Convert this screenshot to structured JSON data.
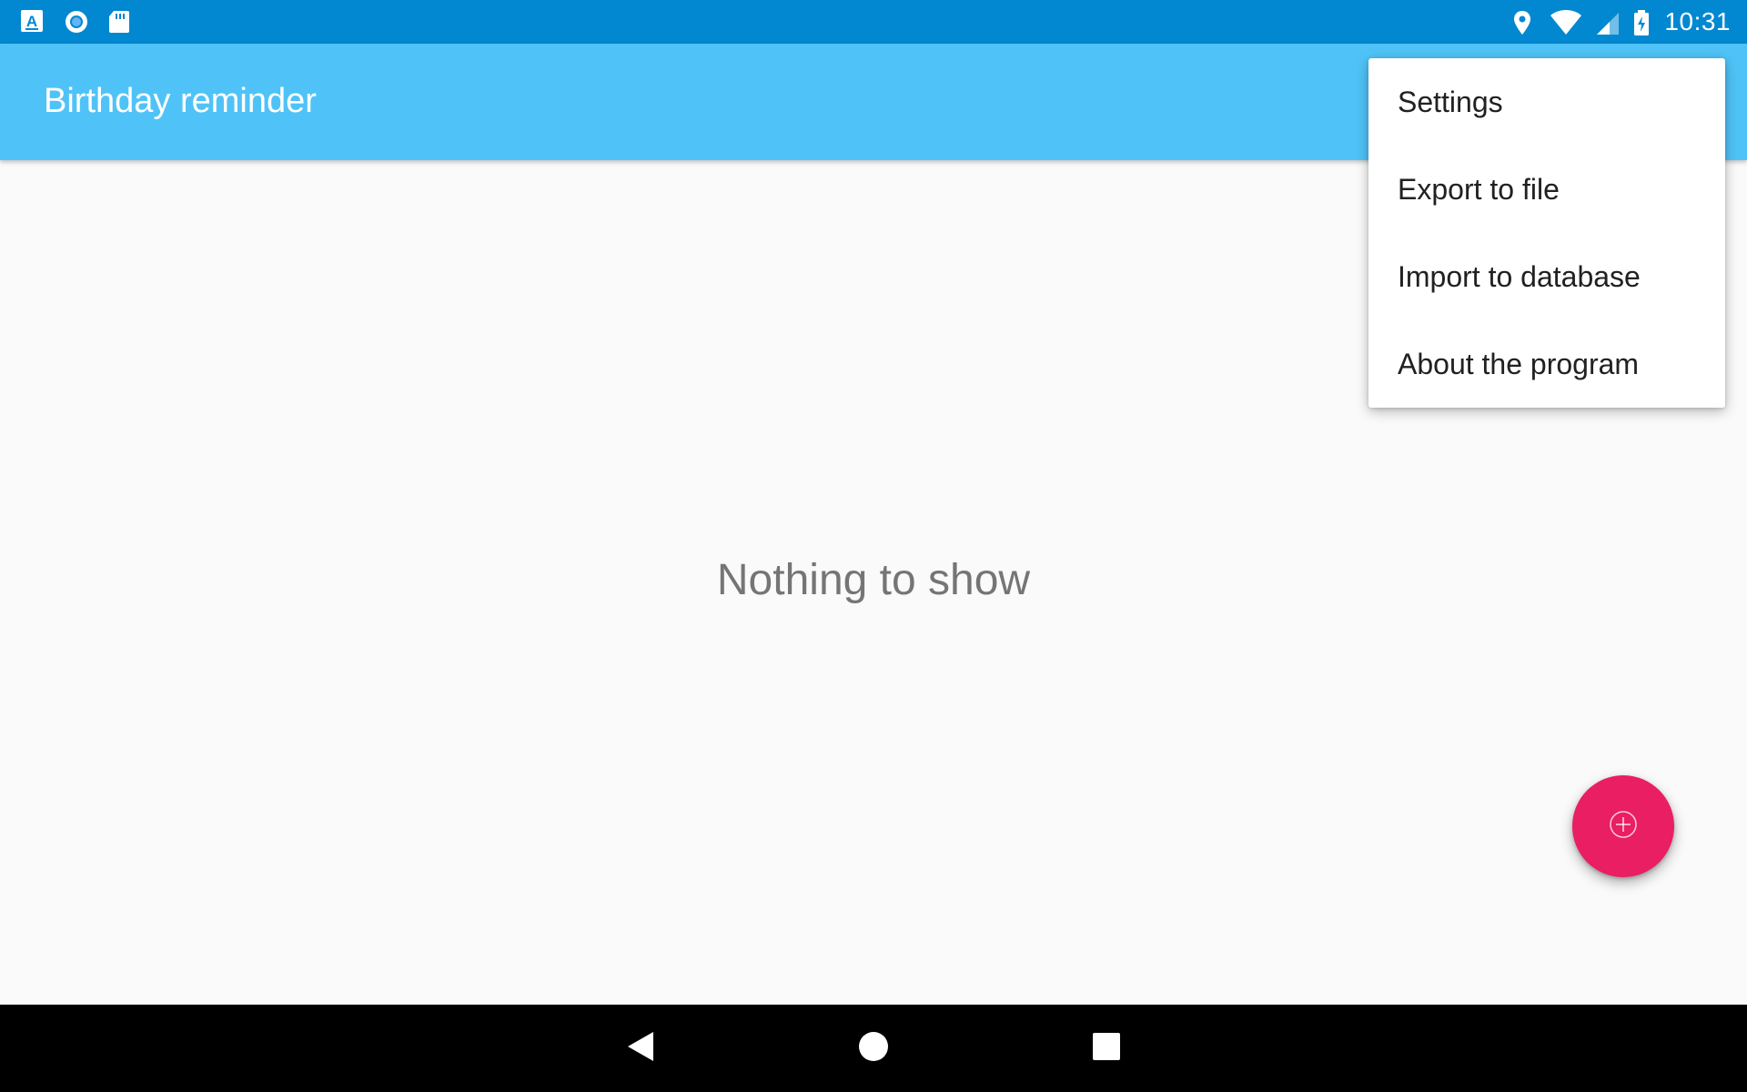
{
  "status_bar": {
    "left_icons": [
      "text-a-icon",
      "sync-circle-icon",
      "sd-card-icon"
    ],
    "right_icons": [
      "location-icon",
      "wifi-icon",
      "cell-signal-icon",
      "battery-charging-icon"
    ],
    "time": "10:31",
    "color": "#0288D1"
  },
  "app_bar": {
    "title": "Birthday reminder",
    "color": "#4FC3F7"
  },
  "main": {
    "empty_message": "Nothing to show"
  },
  "overflow_menu": {
    "items": [
      {
        "label": "Settings"
      },
      {
        "label": "Export to file"
      },
      {
        "label": "Import to database"
      },
      {
        "label": "About the program"
      }
    ]
  },
  "fab": {
    "icon": "add-circle-icon",
    "color": "#E91E63"
  },
  "nav_bar": {
    "buttons": [
      "back-icon",
      "home-icon",
      "recents-icon"
    ]
  }
}
